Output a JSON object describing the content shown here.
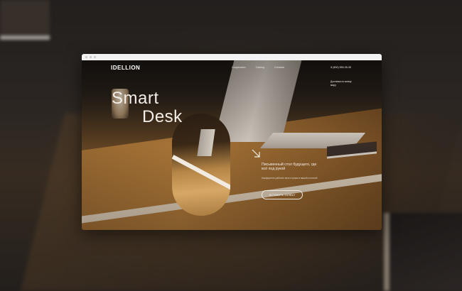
{
  "window": {
    "title": ""
  },
  "brand": {
    "logo": "IDELLION"
  },
  "nav": {
    "items": [
      {
        "label": "Cooperation"
      },
      {
        "label": "Catalog"
      },
      {
        "label": "Contacts"
      }
    ],
    "phone": "8 (800) 555-35-35"
  },
  "delivery": {
    "text": "Доставка по всему миру"
  },
  "hero": {
    "title_line1": "Smart",
    "title_line2": "Desk",
    "tagline": "Письменный стол будущего, где всё под рукой",
    "description": "Комфортное рабочее место прямо в вашей гостиной",
    "cta_label": "ОСТАВИТЬ ЗАЯВКУ"
  },
  "icons": {
    "arrow": "arrow-down-right-icon"
  }
}
